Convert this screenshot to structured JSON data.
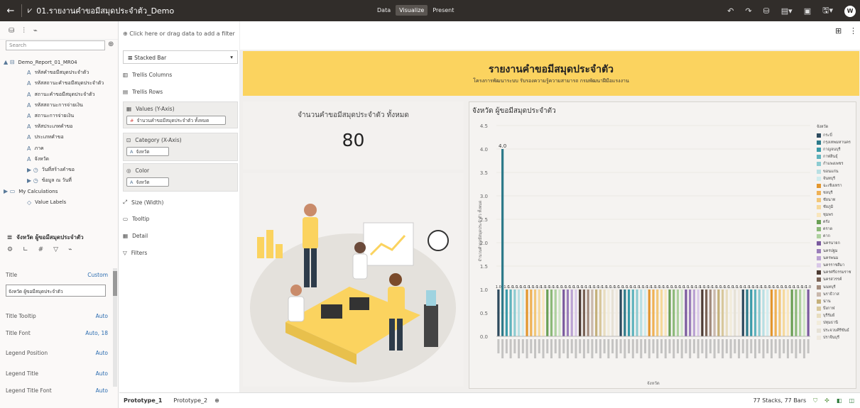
{
  "topbar": {
    "back": "←",
    "title_icon": "⩗",
    "title": "01.รายงานคำขอมีสมุดประจำตัว_Demo",
    "modes": [
      "Data",
      "Visualize",
      "Present"
    ],
    "active_mode": "Visualize",
    "avatar": "W"
  },
  "left": {
    "search_placeholder": "Search",
    "tree": [
      {
        "glyph": "▲ ⊟",
        "label": "Demo_Report_01_MR04",
        "indent": 0
      },
      {
        "glyph": "A",
        "label": "รหัสคำขอมีสมุดประจำตัว",
        "indent": 1
      },
      {
        "glyph": "A",
        "label": "รหัสสถานะคำขอมีสมุดประจำตัว",
        "indent": 1
      },
      {
        "glyph": "A",
        "label": "สถานะคำขอมีสมุดประจำตัว",
        "indent": 1
      },
      {
        "glyph": "A",
        "label": "รหัสสถานะการจ่ายเงิน",
        "indent": 1
      },
      {
        "glyph": "A",
        "label": "สถานะการจ่ายเงิน",
        "indent": 1
      },
      {
        "glyph": "A",
        "label": "รหัสประเภทคำขอ",
        "indent": 1
      },
      {
        "glyph": "A",
        "label": "ประเภทคำขอ",
        "indent": 1
      },
      {
        "glyph": "A",
        "label": "ภาค",
        "indent": 1
      },
      {
        "glyph": "A",
        "label": "จังหวัด",
        "indent": 1
      },
      {
        "glyph": "▶ ◷",
        "label": "วันที่สร้างคำขอ",
        "indent": 1
      },
      {
        "glyph": "▶ ◷",
        "label": "ข้อมูล ณ วันที่",
        "indent": 1
      },
      {
        "glyph": "▶ ▭",
        "label": "My Calculations",
        "indent": 0
      },
      {
        "glyph": "◇",
        "label": "Value Labels",
        "indent": 1
      }
    ],
    "viz_title": "จังหวัด ผู้ขอมีสมุดประจำตัว",
    "props": [
      {
        "label": "Title",
        "value": "Custom",
        "top": 8
      },
      {
        "label": "Title Tooltip",
        "value": "Auto",
        "top": 66
      },
      {
        "label": "Title Font",
        "value": "Auto, 18",
        "top": 90
      },
      {
        "label": "Legend Position",
        "value": "Auto",
        "top": 118
      },
      {
        "label": "Legend Title",
        "value": "Auto",
        "top": 147
      },
      {
        "label": "Legend Title Font",
        "value": "Auto",
        "top": 171
      }
    ],
    "title_value": "จังหวัด ผู้ขอมีสมุดประจำตัว"
  },
  "grammar": {
    "dropbar": "Click here or drag data to add a filter",
    "viz_type": "Stacked Bar",
    "trellis_columns": "Trellis Columns",
    "trellis_rows": "Trellis Rows",
    "values_label": "Values (Y-Axis)",
    "values_pill": "จำนวนคำขอมีสมุดประจำตัว ทั้งหมด",
    "category_label": "Category (X-Axis)",
    "category_pill": "จังหวัด",
    "color_label": "Color",
    "color_pill": "จังหวัด",
    "size": "Size (Width)",
    "tooltip": "Tooltip",
    "detail": "Detail",
    "filters": "Filters"
  },
  "canvas": {
    "banner_title": "รายงานคำขอมีสมุดประจำตัว",
    "banner_subtitle": "โครงการพัฒนาระบบ รับรองความรู้ความสามารถ กรมพัฒนาฝีมือแรงงาน",
    "kpi_title": "จำนวนคำขอมีสมุดประจำตัว ทั้งหมด",
    "kpi_value": "80"
  },
  "chart_data": {
    "type": "bar",
    "title": "จังหวัด ผู้ขอมีสมุดประจำตัว",
    "xlabel": "จังหวัด",
    "ylabel": "จำนวนคำขอมีสมุดประจำตัว ทั้งหมด",
    "ylim": [
      0,
      4.5
    ],
    "yticks": [
      "0.0",
      "0.5",
      "1.0",
      "1.5",
      "2.0",
      "2.5",
      "3.0",
      "3.5",
      "4.0",
      "4.5"
    ],
    "grid": true,
    "legend_position": "right",
    "legend_title": "จังหวัด",
    "value_labels": [
      "4.0",
      "1.0"
    ],
    "bar_count": 77,
    "values": [
      1,
      4,
      1,
      1,
      1,
      1,
      1,
      1,
      1,
      1,
      1,
      1,
      1,
      1,
      1,
      1,
      1,
      1,
      1,
      1,
      1,
      1,
      1,
      1,
      1,
      1,
      1,
      1,
      1,
      1,
      1,
      1,
      1,
      1,
      1,
      1,
      1,
      1,
      1,
      1,
      1,
      1,
      1,
      1,
      1,
      1,
      1,
      1,
      1,
      1,
      1,
      1,
      1,
      1,
      1,
      1,
      1,
      1,
      1,
      1,
      1,
      1,
      1,
      1,
      1,
      1,
      1,
      1,
      1,
      1,
      1,
      1,
      1,
      1,
      1,
      1,
      1
    ],
    "colors": [
      "#2d4a5e",
      "#2d7a8a",
      "#3a9aa8",
      "#5fb3bd",
      "#8ccbd1",
      "#b8dfe3",
      "#d0ecee",
      "#e3962e",
      "#efb155",
      "#f2c778",
      "#f6d89a",
      "#f9e6bd",
      "#6a9f55",
      "#8cb979",
      "#aed19f",
      "#d0e6c7",
      "#7a5a9e",
      "#9a7dba",
      "#bba2d3",
      "#d9c8e8",
      "#4d3b33",
      "#7a6356",
      "#a38c7e",
      "#c9b8ac",
      "#c4b07a",
      "#d8c89c",
      "#e8ddbf",
      "#f2ecdb",
      "#e6e1d5",
      "#efe9df"
    ],
    "legend": [
      "กระบี่",
      "กรุงเทพมหานคร",
      "กาญจนบุรี",
      "กาฬสินธุ์",
      "กำแพงเพชร",
      "ขอนแก่น",
      "จันทบุรี",
      "ฉะเชิงเทรา",
      "ชลบุรี",
      "ชัยนาท",
      "ชัยภูมิ",
      "ชุมพร",
      "เชียงราย",
      "เชียงใหม่",
      "ตรัง",
      "ตราด",
      "ตาก",
      "นครนายก",
      "นครปฐม",
      "นครพนม",
      "นครราชสีมา",
      "นครศรีธรรมราช",
      "นครสวรรค์",
      "นนทบุรี",
      "นราธิวาส",
      "น่าน",
      "บึงกาฬ",
      "บุรีรัมย์",
      "ปทุมธานี",
      "ประจวบคีรีขันธ์",
      "ปราจีนบุรี"
    ],
    "legend_shown": [
      "กระบี่",
      "กรุงเทพมหานคร",
      "กาญจนบุรี",
      "กาฬสินธุ์",
      "กำแพงเพชร",
      "ขอนแก่น",
      "จันทบุรี",
      "ฉะเชิงเทรา",
      "ชลบุรี",
      "ชัยนาท",
      "ชัยภูมิ",
      "ชุมพร",
      "ตรัง",
      "ตราด",
      "ตาก",
      "นครนายก",
      "นครปฐม",
      "นครพนม",
      "นครราชสีมา",
      "นครศรีธรรมราช",
      "นครสวรรค์",
      "นนทบุรี",
      "นราธิวาส",
      "น่าน",
      "บึงกาฬ",
      "บุรีรัมย์",
      "ปทุมธานี",
      "ประจวบคีรีขันธ์",
      "ปราจีนบุรี"
    ],
    "legend_colors": [
      "#2d4a5e",
      "#2d7a8a",
      "#3a9aa8",
      "#5fb3bd",
      "#8ccbd1",
      "#b8dfe3",
      "#d0ecee",
      "#e3962e",
      "#efb155",
      "#f2c778",
      "#f6d89a",
      "#f9e6bd",
      "#6a9f55",
      "#8cb979",
      "#aed19f",
      "#7a5a9e",
      "#9a7dba",
      "#bba2d3",
      "#d9c8e8",
      "#4d3b33",
      "#7a6356",
      "#a38c7e",
      "#c9b8ac",
      "#c4b07a",
      "#d8c89c",
      "#e8ddbf",
      "#f2ecdb",
      "#e6e1d5",
      "#efe9df"
    ]
  },
  "bottom": {
    "tabs": [
      "Prototype_1",
      "Prototype_2"
    ],
    "status": "77 Stacks, 77 Bars"
  },
  "colors": {
    "topbar": "#312d2a",
    "banner": "#fbd35f",
    "accent": "#2b6cb0"
  }
}
